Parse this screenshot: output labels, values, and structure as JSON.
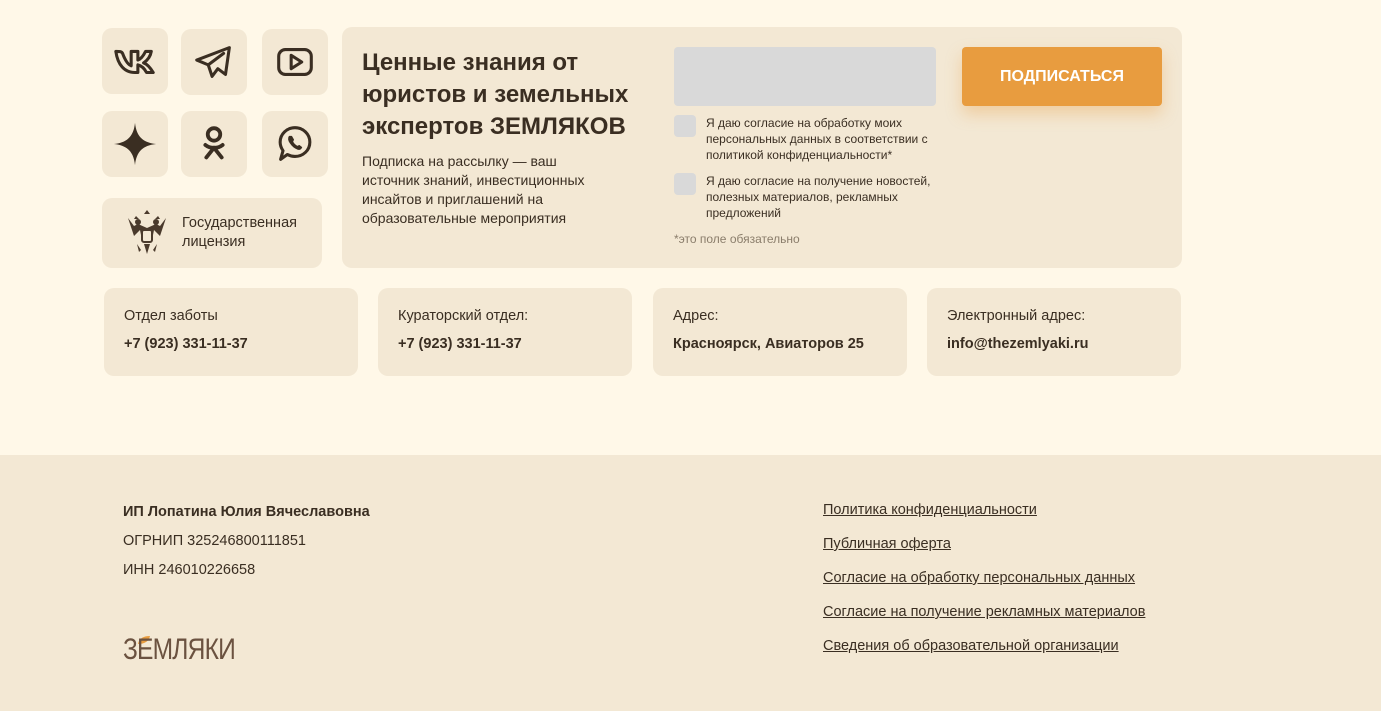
{
  "social": [
    {
      "name": "vk-icon"
    },
    {
      "name": "telegram-icon"
    },
    {
      "name": "youtube-icon"
    },
    {
      "name": "sparkle-icon"
    },
    {
      "name": "odnoklassniki-icon"
    },
    {
      "name": "whatsapp-icon"
    }
  ],
  "license": {
    "label": "Государственная лицензия"
  },
  "subscribe": {
    "title": "Ценные знания от юристов и земельных экспертов ЗЕМЛЯКОВ",
    "description": "Подписка на рассылку — ваш источник знаний, инвестиционных инсайтов и приглашений на образовательные мероприятия",
    "email_placeholder": "",
    "consent_personal": "Я даю согласие на обработку моих персональных данных в соответствии с политикой конфиденциальности*",
    "consent_news": "Я даю согласие на получение новостей, полезных материалов, рекламных предложений",
    "required_note": "*это поле обязательно",
    "button_label": "Подписаться"
  },
  "contacts": [
    {
      "label": "Отдел заботы",
      "value": "+7 (923) 331-11-37"
    },
    {
      "label": "Кураторский отдел:",
      "value": "+7 (923) 331-11-37"
    },
    {
      "label": "Адрес:",
      "value": "Красноярск, Авиаторов 25"
    },
    {
      "label": "Электронный адрес:",
      "value": "info@thezemlyaki.ru"
    }
  ],
  "footer": {
    "company_name": "ИП Лопатина Юлия Вячеславовна",
    "ogrnip": "ОГРНИП 325246800111851",
    "inn": "ИНН 246010226658",
    "logo_text": "ЗЕМЛЯКИ",
    "links": [
      "Политика конфиденциальности",
      "Публичная оферта",
      "Согласие на обработку персональных данных",
      "Согласие на получение рекламных материалов",
      "Сведения об образовательной организации"
    ]
  },
  "colors": {
    "page_bg": "#fff8e8",
    "card_bg": "#f3e8d4",
    "accent": "#e89c3f",
    "text": "#3a2e22",
    "input_bg": "#d9d9d9"
  }
}
